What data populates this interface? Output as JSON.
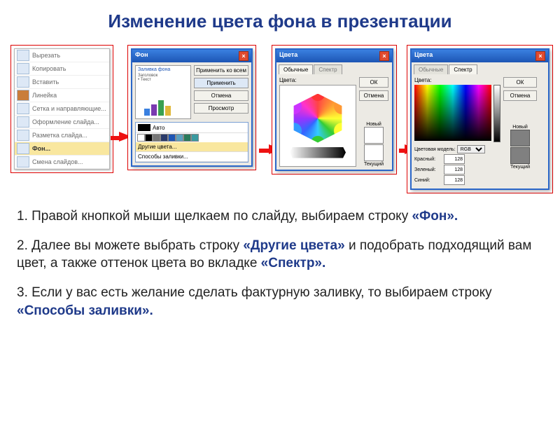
{
  "title": "Изменение цвета фона в презентации",
  "ctxmenu": {
    "items": [
      "Вырезать",
      "Копировать",
      "Вставить",
      "Линейка",
      "Сетка и направляющие...",
      "Оформление слайда...",
      "Разметка слайда...",
      "Фон...",
      "Смена слайдов..."
    ]
  },
  "dialog_fon": {
    "title": "Фон",
    "preview_header": "Заливка фона",
    "preview_sub1": "Заголовок",
    "preview_sub2": "• Текст",
    "btn_apply_all": "Применить ко всем",
    "btn_apply": "Применить",
    "btn_cancel": "Отмена",
    "btn_preview": "Просмотр",
    "dd_auto": "Авто",
    "dd_other": "Другие цвета...",
    "dd_fill": "Способы заливки..."
  },
  "dialog_colors_std": {
    "title": "Цвета",
    "tab1": "Обычные",
    "tab2": "Спектр",
    "label_colors": "Цвета:",
    "btn_ok": "ОК",
    "btn_cancel": "Отмена",
    "new": "Новый",
    "current": "Текущий"
  },
  "dialog_colors_spec": {
    "title": "Цвета",
    "tab1": "Обычные",
    "tab2": "Спектр",
    "label_colors": "Цвета:",
    "btn_ok": "ОК",
    "btn_cancel": "Отмена",
    "model_label": "Цветовая модель:",
    "model": "RGB",
    "r_label": "Красный:",
    "g_label": "Зеленый:",
    "b_label": "Синий:",
    "r": "128",
    "g": "128",
    "b": "128",
    "new": "Новый",
    "current": "Текущий"
  },
  "step1": {
    "pre": "1. Правой кнопкой мыши щелкаем по слайду, выбираем строку ",
    "bold": "«Фон».",
    "post": ""
  },
  "step2": {
    "pre": "2. Далее вы можете выбрать строку ",
    "bold1": "«Другие цвета»",
    "mid": " и подобрать подходящий вам цвет, а также оттенок цвета во вкладке ",
    "bold2": "«Спектр».",
    "post": ""
  },
  "step3": {
    "pre": "3. Если у вас есть желание сделать фактурную заливку, то выбираем строку ",
    "bold": "«Способы заливки».",
    "post": ""
  }
}
